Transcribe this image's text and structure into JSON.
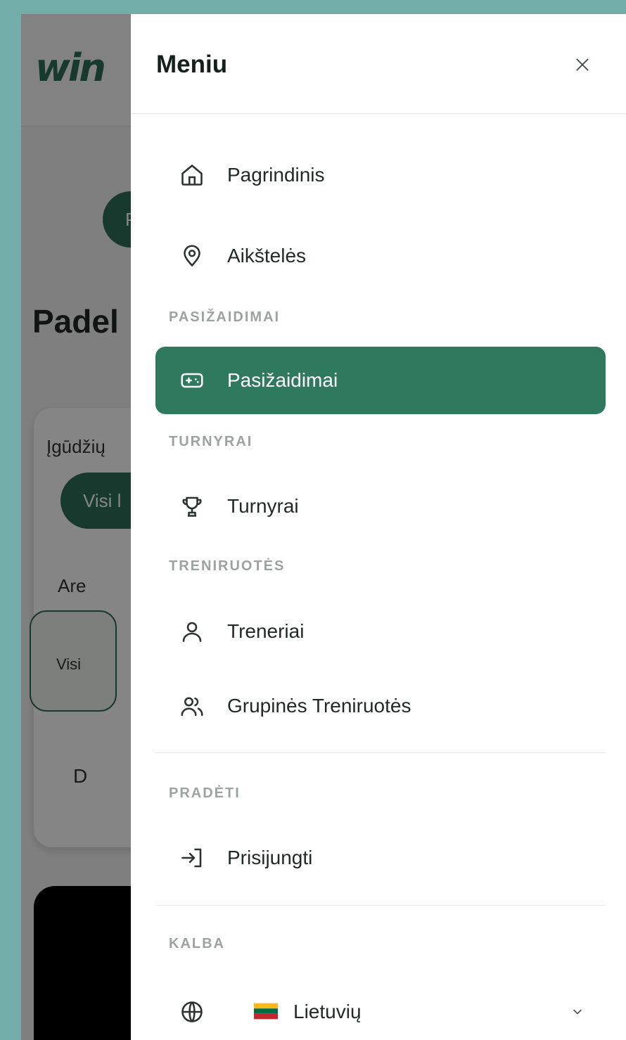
{
  "background": {
    "logo": "win",
    "pill": "P",
    "title": "Padel",
    "label": "Įgūdžių",
    "chip": "Visi l",
    "area": "Are",
    "box": "Visi",
    "filter": "D"
  },
  "drawer": {
    "title": "Meniu",
    "close_icon": "close-icon",
    "nav": [
      {
        "label": "Pagrindinis",
        "icon": "home-icon"
      },
      {
        "label": "Aikštelės",
        "icon": "map-pin-icon"
      }
    ],
    "sections": {
      "pasizaidimai": {
        "title": "PASIŽAIDIMAI",
        "item": {
          "label": "Pasižaidimai",
          "icon": "gamepad-icon",
          "active": true
        }
      },
      "turnyrai": {
        "title": "TURNYRAI",
        "item": {
          "label": "Turnyrai",
          "icon": "trophy-icon"
        }
      },
      "treniruotes": {
        "title": "TRENIRUOTĖS",
        "items": [
          {
            "label": "Treneriai",
            "icon": "user-icon"
          },
          {
            "label": "Grupinės Treniruotės",
            "icon": "users-icon"
          }
        ]
      },
      "pradeti": {
        "title": "PRADĖTI",
        "item": {
          "label": "Prisijungti",
          "icon": "login-icon"
        }
      },
      "kalba": {
        "title": "KALBA",
        "item": {
          "label": "Lietuvių",
          "icon": "globe-icon",
          "flag": "lithuania-flag"
        }
      }
    }
  },
  "colors": {
    "accent": "#2f7a5e",
    "backdrop": "#73ada9"
  }
}
